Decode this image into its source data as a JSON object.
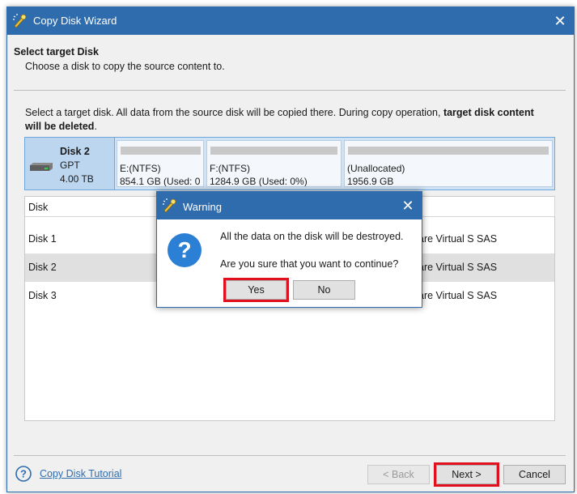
{
  "window": {
    "title": "Copy Disk Wizard",
    "close_glyph": "✕",
    "icon": "wizard-app-icon"
  },
  "header": {
    "title": "Select target Disk",
    "subtitle": "Choose a disk to copy the source content to."
  },
  "instructions": {
    "text": "Select a target disk. All data from the source disk will be copied there. During copy operation, ",
    "bold": "target disk content will be deleted",
    "end": "."
  },
  "disk_map": {
    "name": "Disk 2",
    "style": "GPT",
    "size": "4.00 TB",
    "partitions": [
      {
        "label": "E:(NTFS)",
        "info": "854.1 GB (Used: 0",
        "usage_fraction": 0.0
      },
      {
        "label": "F:(NTFS)",
        "info": "1284.9 GB (Used: 0%)",
        "usage_fraction": 0.0
      },
      {
        "label": "(Unallocated)",
        "info": "1956.9 GB",
        "usage_fraction": 0.0
      }
    ]
  },
  "disk_list": {
    "column_header": "Disk",
    "rows": [
      {
        "disk": "Disk 1",
        "model": "are Virtual S SAS",
        "selected": false
      },
      {
        "disk": "Disk 2",
        "model": "are Virtual S SAS",
        "selected": true
      },
      {
        "disk": "Disk 3",
        "model": "are Virtual S SAS",
        "selected": false
      }
    ]
  },
  "footer": {
    "tutorial_link": "Copy Disk Tutorial",
    "back_label": "< Back",
    "next_label": "Next >",
    "cancel_label": "Cancel"
  },
  "dialog": {
    "title": "Warning",
    "close_glyph": "✕",
    "message1": "All the data on the disk will be destroyed.",
    "message2": "Are you sure that you want to continue?",
    "yes_label": "Yes",
    "no_label": "No",
    "icon": "question-icon"
  },
  "colors": {
    "accent": "#2f6cad",
    "highlight": "#e0101f",
    "selected_map": "#cfe3f5"
  }
}
